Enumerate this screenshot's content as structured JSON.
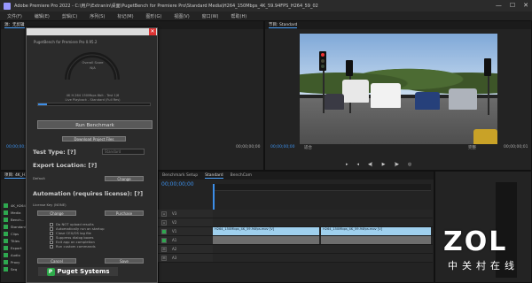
{
  "window": {
    "title": "Adobe Premiere Pro 2022 - C:\\用户\\Extranin\\桌面\\PugetBench for Premiere Pro\\Standard Media\\H264_150Mbps_4K_59.94FPS_H264_59_02",
    "controls": [
      "—",
      "☐",
      "✕"
    ]
  },
  "menu": [
    "文件(F)",
    "编辑(E)",
    "剪辑(C)",
    "序列(S)",
    "标记(M)",
    "图形(G)",
    "视图(V)",
    "窗口(W)",
    "帮助(H)"
  ],
  "source_panel": {
    "tab": "源：无剪辑",
    "timecode": "00;00;00;00",
    "timecode_right": "00;00;00;00"
  },
  "program_monitor": {
    "tab": "节目: Standard",
    "timecode": "00;00;00;00",
    "fit": "适合",
    "quality": "完整",
    "duration": "00;00;00;01"
  },
  "project_panel": {
    "tab": "项目: 4K_H264_59...",
    "items": [
      "4K_H264...",
      "Media",
      "Bench...",
      "Standard",
      "Clips",
      "Titles",
      "Export",
      "Audio",
      "Proxy",
      "Seq"
    ]
  },
  "effects_panel": {
    "tabs": [
      "Benchmark Setup",
      "Standard",
      "BenchCam"
    ]
  },
  "dialog": {
    "title": "PugetBench for Premiere Pro 0.95.2",
    "gauge_label": "Overall Score",
    "gauge_value": "N/A",
    "status_line1": "4K H.264 150Mbps 8bit - Test 1/6",
    "status_line2": "Live Playback - Standard (Full Res)",
    "progress_fraction": 0.08,
    "run_button": "Run Benchmark",
    "download_button": "Download Project Files",
    "test_type_label": "Test Type:",
    "test_type_q": "[?]",
    "test_type_value": "Standard",
    "export_label": "Export Location:",
    "export_q": "[?]",
    "export_value": "Default",
    "export_change": "Change",
    "automation_label": "Automation (requires license):",
    "automation_q": "[?]",
    "license_label": "License Key (NONE)",
    "license_change": "Change",
    "license_purchase": "Purchase",
    "options": [
      "Do NOT upload results",
      "Automatically run on startup",
      "Close CEX/OS log file",
      "Suppress dialog boxes",
      "Exit app on completion",
      "Run custom commands"
    ],
    "cancel_button": "Cancel",
    "save_button": "Save",
    "logo_text": "Puget Systems"
  },
  "timeline": {
    "tab": "Standard",
    "timecode": "00;00;00;00",
    "video_clip_a": "H264_150Mbps_4K_59.94fps.mov [V]",
    "video_clip_b": "H264_150Mbps_4K_59.94fps.mov [V]",
    "tracks": [
      "V3",
      "V2",
      "V1",
      "A1",
      "A2",
      "A3"
    ]
  },
  "watermark": {
    "brand": "ZOL",
    "subtitle": "中关村在线"
  },
  "colors": {
    "accent_blue": "#3c8ee8",
    "clip_video": "#9fd0ee",
    "clip_audio": "#7ab87a",
    "close_red": "#dd3333",
    "puget_green": "#2eaa4a"
  }
}
